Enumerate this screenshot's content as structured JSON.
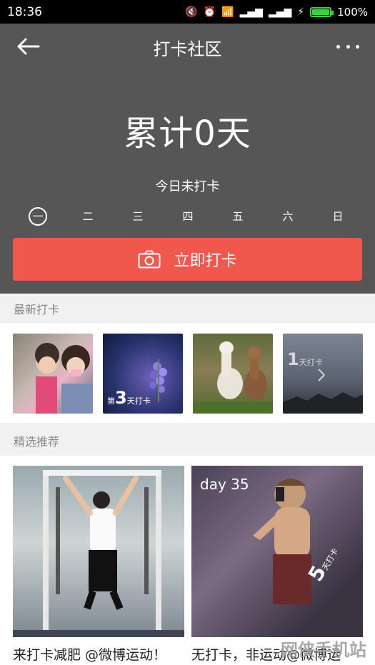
{
  "status": {
    "time": "18:36",
    "battery": "100%",
    "battery_level": 1.0
  },
  "nav": {
    "title": "打卡社区"
  },
  "hero": {
    "total": "累计0天",
    "today": "今日未打卡",
    "week": [
      "一",
      "二",
      "三",
      "四",
      "五",
      "六",
      "日"
    ],
    "button": "立即打卡"
  },
  "latest": {
    "title": "最新打卡",
    "thumbs": [
      {
        "caption_pre": "",
        "caption_num": "",
        "caption_post": ""
      },
      {
        "caption_pre": "第",
        "caption_num": "3",
        "caption_post": "天打卡"
      },
      {
        "caption_pre": "",
        "caption_num": "",
        "caption_post": ""
      },
      {
        "caption_pre": "",
        "caption_num": "1",
        "caption_post": "天打卡"
      }
    ]
  },
  "picks": {
    "title": "精选推荐",
    "cards": [
      {
        "text": "来打卡减肥 @微博运动！"
      },
      {
        "text": "无打卡，非运动@微博运",
        "overlay": "day 35",
        "badge_num": "5",
        "badge_text": "天打卡"
      }
    ]
  },
  "watermark": "网侠手机站",
  "colors": {
    "hero_bg": "#565656",
    "accent": "#f0584e"
  }
}
